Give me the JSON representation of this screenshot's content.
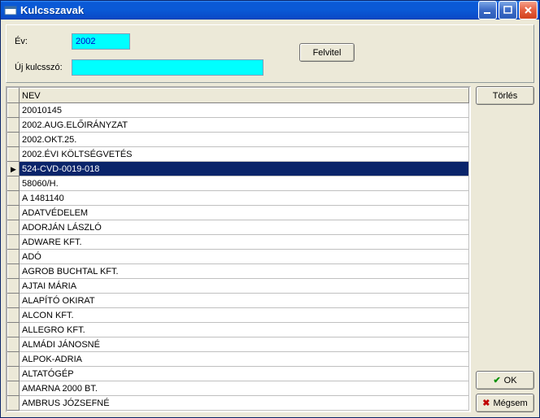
{
  "window": {
    "title": "Kulcsszavak"
  },
  "form": {
    "year_label": "Év:",
    "year_value": "2002",
    "keyword_label": "Új kulcsszó:",
    "keyword_value": "",
    "felvitel": "Felvitel"
  },
  "grid": {
    "header": "NEV",
    "selected_index": 4,
    "rows": [
      "20010145",
      "2002.AUG.ELŐIRÁNYZAT",
      "2002.OKT.25.",
      "2002.ÉVI KÖLTSÉGVETÉS",
      "524-CVD-0019-018",
      "58060/H.",
      "A 1481140",
      "ADATVÉDELEM",
      "ADORJÁN LÁSZLÓ",
      "ADWARE KFT.",
      "ADÓ",
      "AGROB BUCHTAL KFT.",
      "AJTAI MÁRIA",
      "ALAPÍTÓ OKIRAT",
      "ALCON KFT.",
      "ALLEGRO KFT.",
      "ALMÁDI JÁNOSNÉ",
      "ALPOK-ADRIA",
      "ALTATÓGÉP",
      "AMARNA 2000 BT.",
      "AMBRUS JÓZSEFNÉ"
    ]
  },
  "buttons": {
    "torles": "Törlés",
    "ok": "OK",
    "megsem": "Mégsem"
  }
}
